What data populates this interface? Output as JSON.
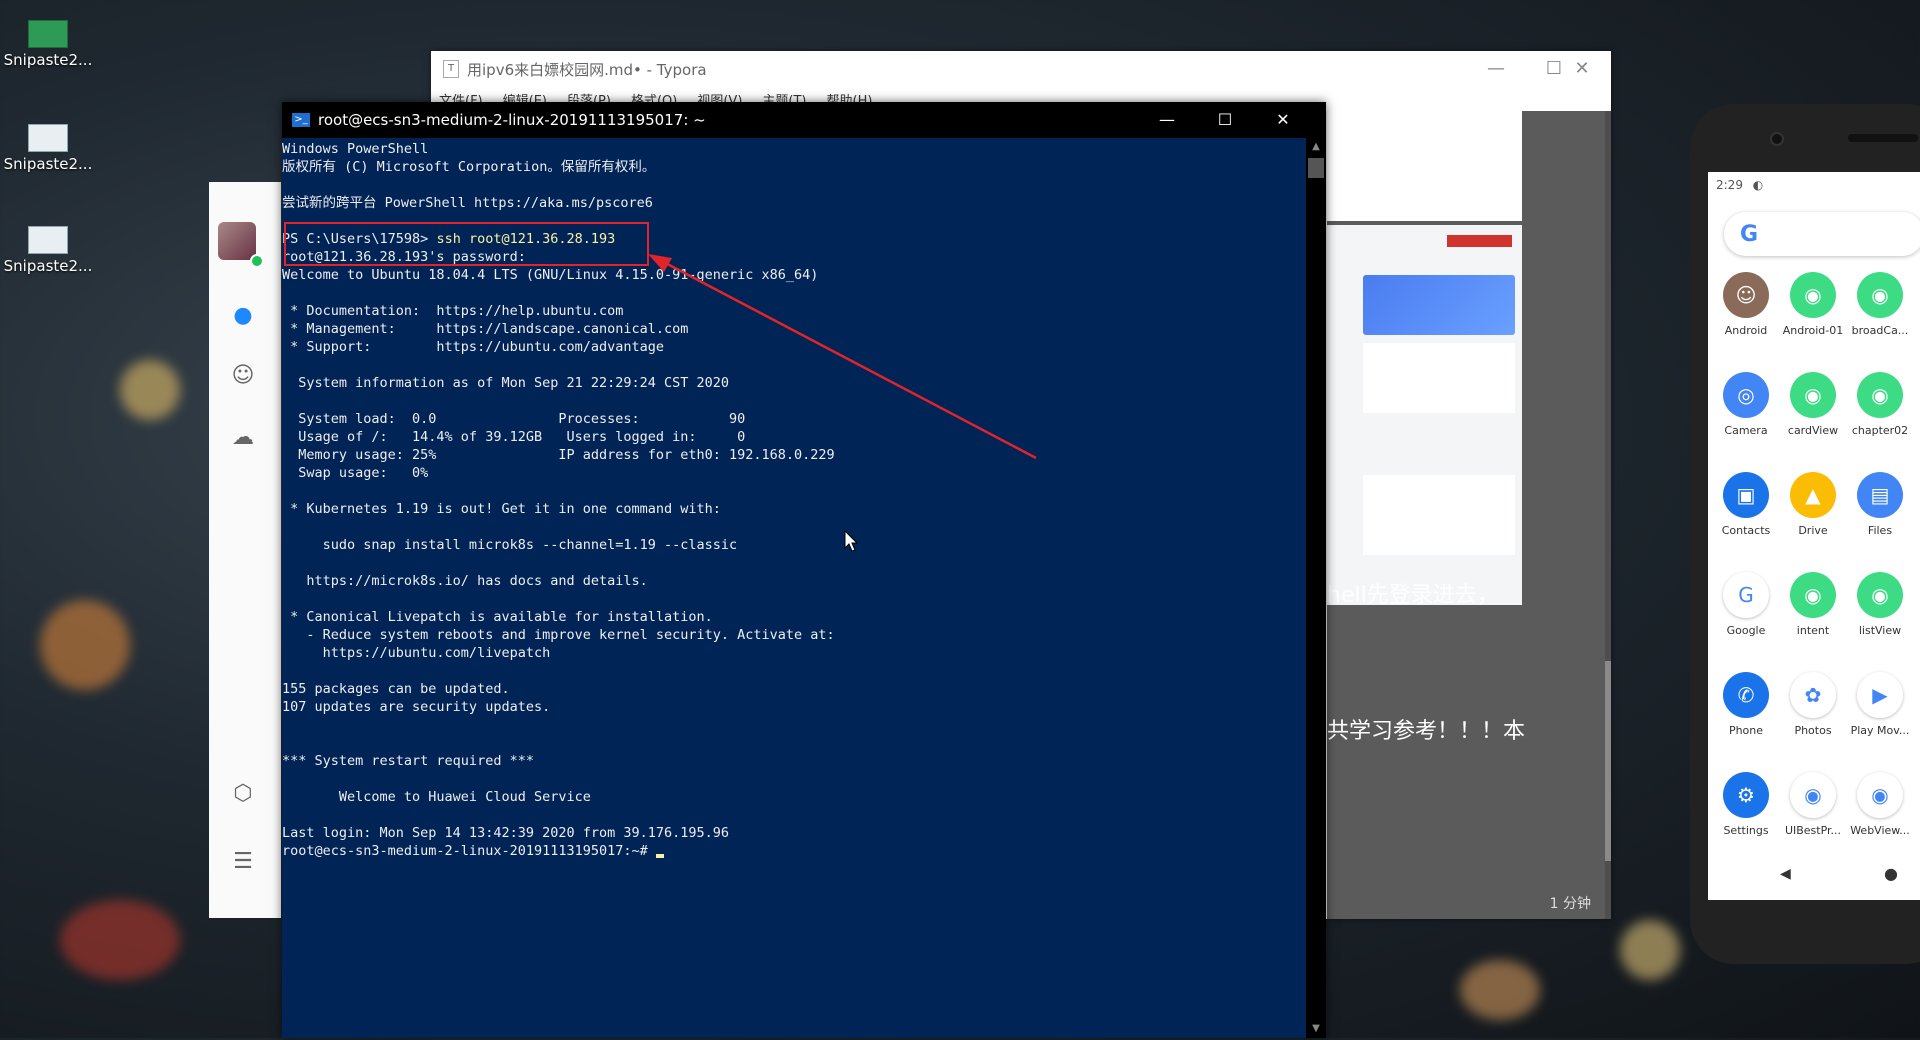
{
  "desktop": {
    "icons": [
      {
        "label": "Snipaste2..."
      },
      {
        "label": "Snipaste2..."
      },
      {
        "label": "Snipaste2..."
      }
    ]
  },
  "typora": {
    "title": "用ipv6来白嫖校园网.md• - Typora",
    "menu": [
      "文件(F)",
      "编辑(E)",
      "段落(P)",
      "格式(O)",
      "视图(V)",
      "主题(T)",
      "帮助(H)"
    ],
    "text_lines": [
      "hell先登录进去，",
      "共学习参考！！！本"
    ],
    "status": "1 分钟"
  },
  "powershell": {
    "title": "root@ecs-sn3-medium-2-linux-20191113195017: ~",
    "lines": [
      "Windows PowerShell",
      "版权所有 (C) Microsoft Corporation。保留所有权利。",
      "",
      "尝试新的跨平台 PowerShell https://aka.ms/pscore6",
      "",
      "",
      "root@121.36.28.193's password:",
      "Welcome to Ubuntu 18.04.4 LTS (GNU/Linux 4.15.0-91-generic x86_64)",
      "",
      " * Documentation:  https://help.ubuntu.com",
      " * Management:     https://landscape.canonical.com",
      " * Support:        https://ubuntu.com/advantage",
      "",
      "  System information as of Mon Sep 21 22:29:24 CST 2020",
      "",
      "  System load:  0.0               Processes:           90",
      "  Usage of /:   14.4% of 39.12GB   Users logged in:     0",
      "  Memory usage: 25%               IP address for eth0: 192.168.0.229",
      "  Swap usage:   0%",
      "",
      " * Kubernetes 1.19 is out! Get it in one command with:",
      "",
      "     sudo snap install microk8s --channel=1.19 --classic",
      "",
      "   https://microk8s.io/ has docs and details.",
      "",
      " * Canonical Livepatch is available for installation.",
      "   - Reduce system reboots and improve kernel security. Activate at:",
      "     https://ubuntu.com/livepatch",
      "",
      "155 packages can be updated.",
      "107 updates are security updates.",
      "",
      "",
      "*** System restart required ***",
      "",
      "       Welcome to Huawei Cloud Service",
      "",
      "Last login: Mon Sep 14 13:42:39 2020 from 39.176.195.96",
      "root@ecs-sn3-medium-2-linux-20191113195017:~# "
    ],
    "prompt_prefix": "PS C:\\Users\\17598> ",
    "prompt_command": "ssh root@121.36.28.193",
    "highlight_color": "#e0242a"
  },
  "phone": {
    "time": "2:29",
    "apps": [
      {
        "name": "Android",
        "color": "#8a6b5a",
        "glyph": "☺"
      },
      {
        "name": "Android-01",
        "color": "#3ddc84",
        "glyph": "◉"
      },
      {
        "name": "broadCa...",
        "color": "#3ddc84",
        "glyph": "◉"
      },
      {
        "name": "Camera",
        "color": "#4285f4",
        "glyph": "◎"
      },
      {
        "name": "cardView",
        "color": "#3ddc84",
        "glyph": "◉"
      },
      {
        "name": "chapter02",
        "color": "#3ddc84",
        "glyph": "◉"
      },
      {
        "name": "Contacts",
        "color": "#1a73e8",
        "glyph": "▣"
      },
      {
        "name": "Drive",
        "color": "#fbbc04",
        "glyph": "▲"
      },
      {
        "name": "Files",
        "color": "#4285f4",
        "glyph": "▤"
      },
      {
        "name": "Google",
        "color": "#ffffff",
        "glyph": "G"
      },
      {
        "name": "intent",
        "color": "#3ddc84",
        "glyph": "◉"
      },
      {
        "name": "listView",
        "color": "#3ddc84",
        "glyph": "◉"
      },
      {
        "name": "Phone",
        "color": "#1a73e8",
        "glyph": "✆"
      },
      {
        "name": "Photos",
        "color": "#ffffff",
        "glyph": "✿"
      },
      {
        "name": "Play Mov...",
        "color": "#ffffff",
        "glyph": "▶"
      },
      {
        "name": "Settings",
        "color": "#1a73e8",
        "glyph": "⚙"
      },
      {
        "name": "UIBestPr...",
        "color": "#ffffff",
        "glyph": "◉"
      },
      {
        "name": "WebView...",
        "color": "#ffffff",
        "glyph": "◉"
      }
    ]
  }
}
